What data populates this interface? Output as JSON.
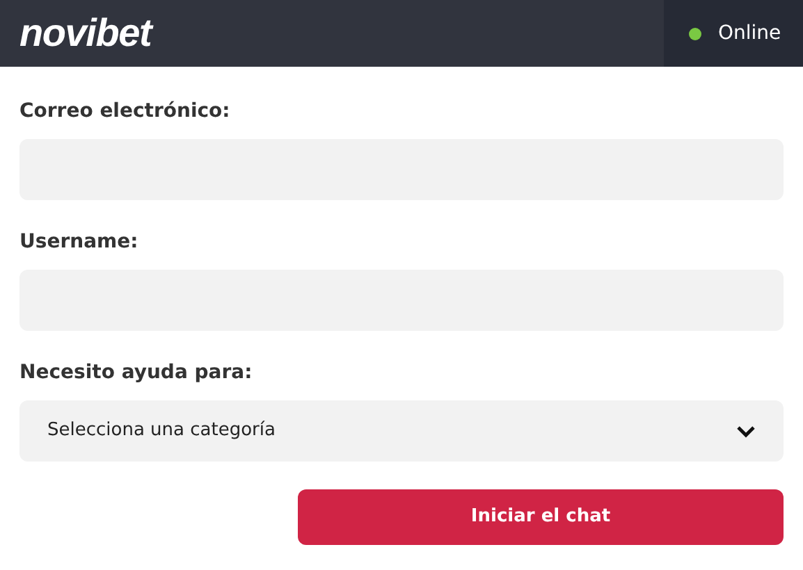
{
  "header": {
    "logo": "novibet",
    "status": {
      "label": "Online",
      "online": true
    }
  },
  "fields": [
    {
      "kind": "text",
      "label": "Correo electrónico:"
    },
    {
      "kind": "text",
      "label": "Username:"
    },
    {
      "kind": "select",
      "label": "Necesito ayuda para:",
      "placeholder": "Selecciona una categoría"
    }
  ],
  "submit": "Iniciar el chat"
}
